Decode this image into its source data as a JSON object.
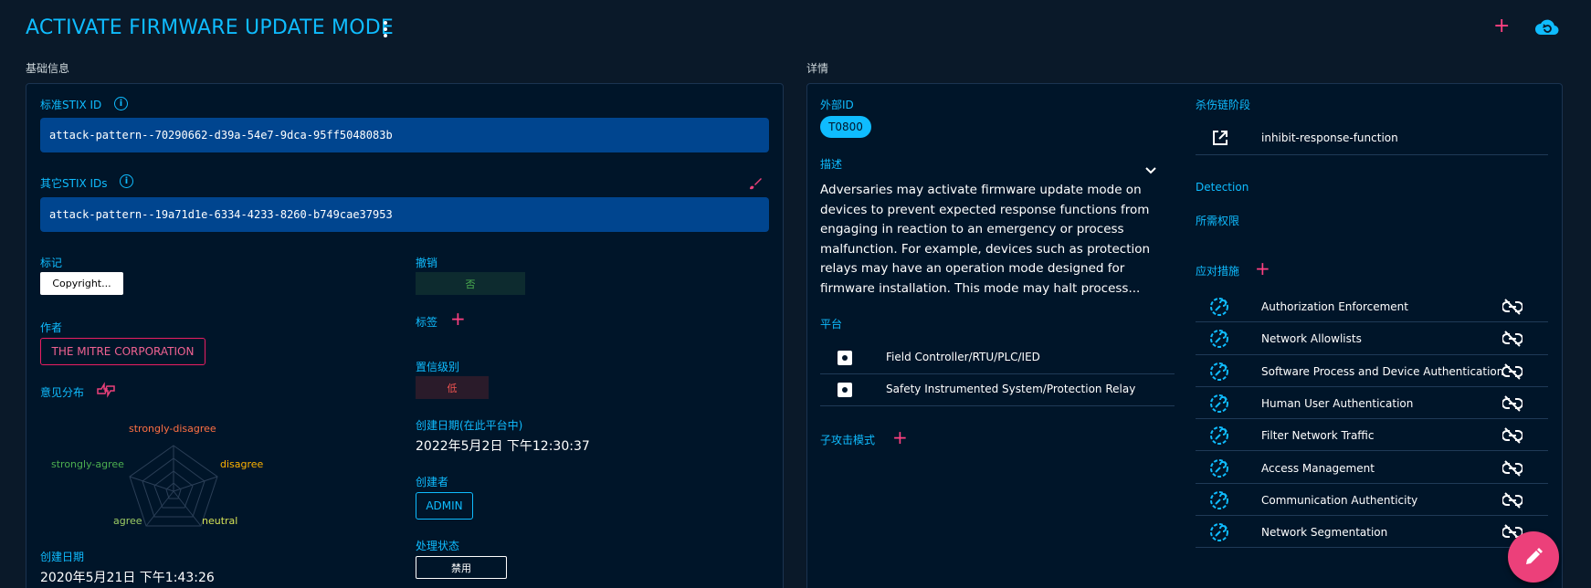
{
  "header": {
    "title": "ACTIVATE FIRMWARE UPDATE MODE",
    "icons": [
      "more-vert-icon",
      "plus-icon",
      "cloud-refresh-icon"
    ]
  },
  "basic": {
    "section_title": "基础信息",
    "stix_id_label": "标准STIX ID",
    "stix_id_value": "attack-pattern--70290662-d39a-54e7-9dca-95ff5048083b",
    "other_ids_label": "其它STIX IDs",
    "other_ids_value": "attack-pattern--19a71d1e-6334-4233-8260-b749cae37953",
    "marking_label": "标记",
    "marking_value": "Copyright...",
    "author_label": "作者",
    "author_value": "THE MITRE CORPORATION",
    "opinion_label": "意见分布",
    "radar_labels": {
      "strongly_disagree": "strongly-disagree",
      "disagree": "disagree",
      "neutral": "neutral",
      "agree": "agree",
      "strongly_agree": "strongly-agree"
    },
    "created_label": "创建日期",
    "created_value": "2020年5月21日 下午1:43:26",
    "revoked_label": "撤销",
    "revoked_value": "否",
    "tags_label": "标签",
    "confidence_label": "置信级别",
    "confidence_value": "低",
    "platform_created_label": "创建日期(在此平台中)",
    "platform_created_value": "2022年5月2日 下午12:30:37",
    "creator_label": "创建者",
    "creator_value": "ADMIN",
    "status_label": "处理状态",
    "status_value": "禁用"
  },
  "details": {
    "section_title": "详情",
    "external_id_label": "外部ID",
    "external_id_value": "T0800",
    "description_label": "描述",
    "description_text": "Adversaries may activate firmware update mode on devices to prevent expected response functions from engaging in reaction to an emergency or process malfunction. For example, devices such as protection relays may have an operation mode designed for firmware installation. This mode may halt process...",
    "platforms_label": "平台",
    "platforms": [
      "Field Controller/RTU/PLC/IED",
      "Safety Instrumented System/Protection Relay"
    ],
    "sub_techniques_label": "子攻击模式",
    "kill_chain_label": "杀伤链阶段",
    "kill_chain_value": "inhibit-response-function",
    "detection_label": "Detection",
    "permissions_label": "所需权限",
    "mitigations_label": "应对措施",
    "mitigations": [
      "Authorization Enforcement",
      "Network Allowlists",
      "Software Process and Device Authentication",
      "Human User Authentication",
      "Filter Network Traffic",
      "Access Management",
      "Communication Authenticity",
      "Network Segmentation"
    ]
  },
  "colors": {
    "accent": "#0fbcff",
    "pink": "#ec407a",
    "background": "#0a1929",
    "card": "#001529",
    "stix_box": "#00458f"
  }
}
